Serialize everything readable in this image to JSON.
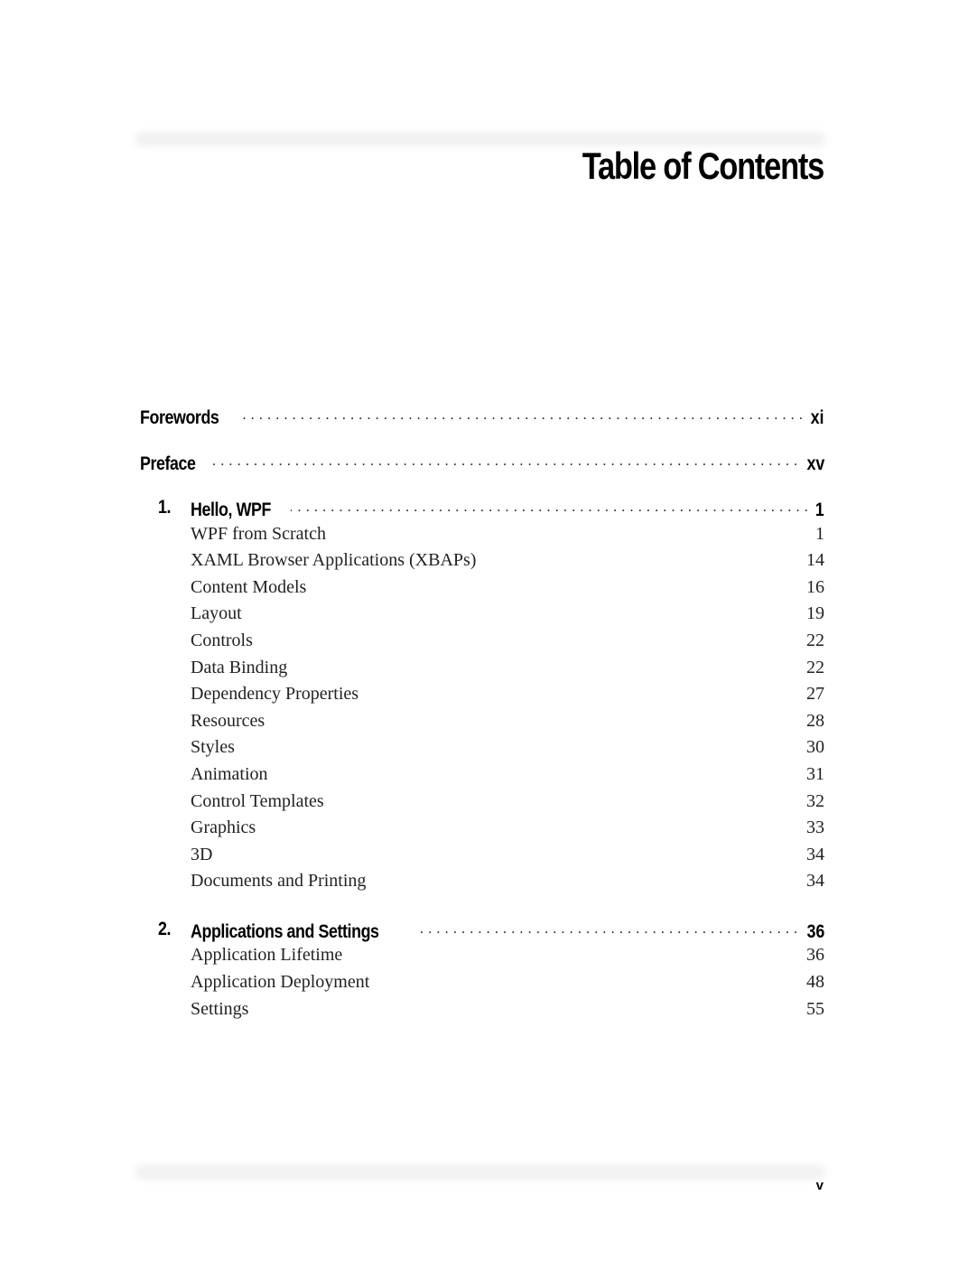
{
  "page": {
    "title": "Table of Contents",
    "page_number": "v"
  },
  "toc": {
    "front_matter": [
      {
        "label": "Forewords",
        "page": "xi"
      },
      {
        "label": "Preface",
        "page": "xv"
      }
    ],
    "chapters": [
      {
        "number": "1.",
        "label": "Hello, WPF",
        "page": "1",
        "sections": [
          {
            "label": "WPF from Scratch",
            "page": "1"
          },
          {
            "label": "XAML Browser Applications (XBAPs)",
            "page": "14"
          },
          {
            "label": "Content Models",
            "page": "16"
          },
          {
            "label": "Layout",
            "page": "19"
          },
          {
            "label": "Controls",
            "page": "22"
          },
          {
            "label": "Data Binding",
            "page": "22"
          },
          {
            "label": "Dependency Properties",
            "page": "27"
          },
          {
            "label": "Resources",
            "page": "28"
          },
          {
            "label": "Styles",
            "page": "30"
          },
          {
            "label": "Animation",
            "page": "31"
          },
          {
            "label": "Control Templates",
            "page": "32"
          },
          {
            "label": "Graphics",
            "page": "33"
          },
          {
            "label": "3D",
            "page": "34"
          },
          {
            "label": "Documents and Printing",
            "page": "34"
          }
        ]
      },
      {
        "number": "2.",
        "label": "Applications and Settings",
        "page": "36",
        "sections": [
          {
            "label": "Application Lifetime",
            "page": "36"
          },
          {
            "label": "Application Deployment",
            "page": "48"
          },
          {
            "label": "Settings",
            "page": "55"
          }
        ]
      }
    ]
  }
}
